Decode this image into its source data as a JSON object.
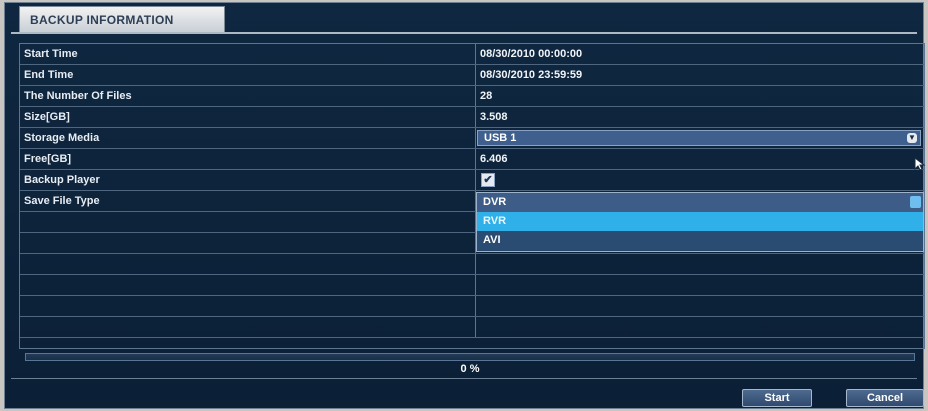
{
  "window": {
    "title": "BACKUP INFORMATION"
  },
  "rows": [
    {
      "label": "Start Time",
      "value": "08/30/2010 00:00:00"
    },
    {
      "label": "End Time",
      "value": "08/30/2010 23:59:59"
    },
    {
      "label": "The Number Of Files",
      "value": "28"
    },
    {
      "label": "Size[GB]",
      "value": "3.508"
    },
    {
      "label": "Storage Media",
      "value": "USB 1"
    },
    {
      "label": "Free[GB]",
      "value": "6.406"
    },
    {
      "label": "Backup Player",
      "value": ""
    },
    {
      "label": "Save File Type",
      "value": ""
    }
  ],
  "storage_media": {
    "selected": "USB 1"
  },
  "backup_player": {
    "checked": true,
    "glyph": "✔"
  },
  "save_file_type": {
    "options": [
      "DVR",
      "RVR",
      "AVI"
    ],
    "highlighted_index": 1
  },
  "progress": {
    "percent": 0,
    "label": "0 %"
  },
  "buttons": {
    "start": "Start",
    "cancel": "Cancel"
  },
  "colors": {
    "background": "#0f2740",
    "highlight": "#2fb0e8",
    "progress_fill": "#5ec3f0"
  }
}
